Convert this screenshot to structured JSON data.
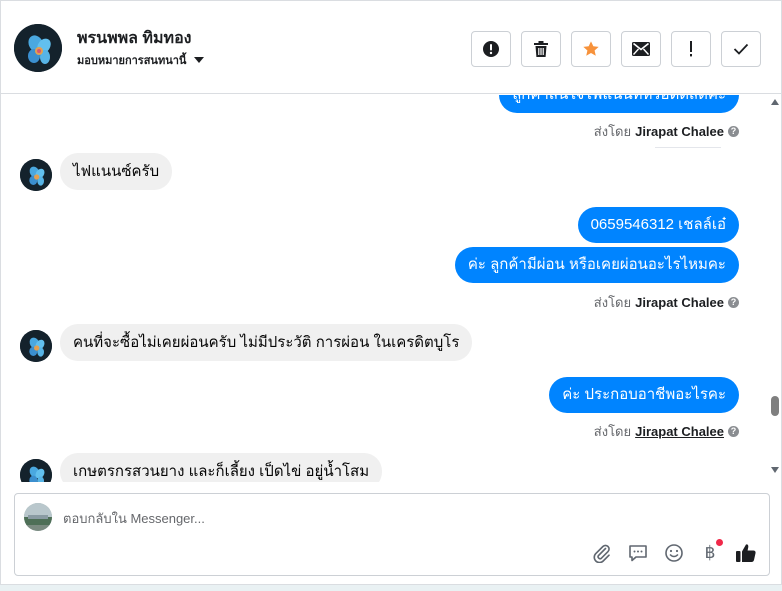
{
  "header": {
    "contact_name": "พรนพพล ทิมทอง",
    "assign_label": "มอบหมายการสนทนานี้",
    "actions": [
      {
        "name": "mark-spam-button",
        "icon": "alert-circle-icon"
      },
      {
        "name": "delete-button",
        "icon": "trash-icon"
      },
      {
        "name": "star-button",
        "icon": "star-icon"
      },
      {
        "name": "mark-unread-button",
        "icon": "envelope-icon"
      },
      {
        "name": "flag-button",
        "icon": "exclamation-icon"
      },
      {
        "name": "mark-done-button",
        "icon": "check-icon"
      }
    ]
  },
  "messages": [
    {
      "id": "m0",
      "direction": "out",
      "text": "ลูกค้าสนใจไฟแนนท์หรือตัดสดคะ",
      "sent_by_prefix": "ส่งโดย",
      "sent_by": "Jirapat Chalee"
    },
    {
      "id": "m1",
      "direction": "in",
      "text": "ไฟแนนซ์ครับ"
    },
    {
      "id": "m2",
      "direction": "out",
      "text": "0659546312 เชลล์เอ๋"
    },
    {
      "id": "m3",
      "direction": "out",
      "text": "ค่ะ ลูกค้ามีผ่อน หรือเคยผ่อนอะไรไหมคะ",
      "sent_by_prefix": "ส่งโดย",
      "sent_by": "Jirapat Chalee"
    },
    {
      "id": "m4",
      "direction": "in",
      "text": "คนที่จะซื้อไม่เคยผ่อนครับ ไม่มีประวัติ การผ่อน ในเครดิตบูโร"
    },
    {
      "id": "m5",
      "direction": "out",
      "text": "ค่ะ ประกอบอาชีพอะไรคะ",
      "sent_by_prefix": "ส่งโดย",
      "sent_by": "Jirapat Chalee"
    },
    {
      "id": "m6",
      "direction": "in",
      "text": "เกษตรกรสวนยาง และก็เลี้ยง เป็ดไข่ อยู่น้ำโสม"
    }
  ],
  "composer": {
    "placeholder": "ตอบกลับใน Messenger...",
    "tools": [
      "paperclip-icon",
      "saved-reply-icon",
      "emoji-icon",
      "baht-payment-icon",
      "thumbs-up-icon"
    ]
  },
  "colors": {
    "outgoing_bubble": "#0084ff",
    "incoming_bubble": "#f0f0f0",
    "star": "#f7923b"
  }
}
